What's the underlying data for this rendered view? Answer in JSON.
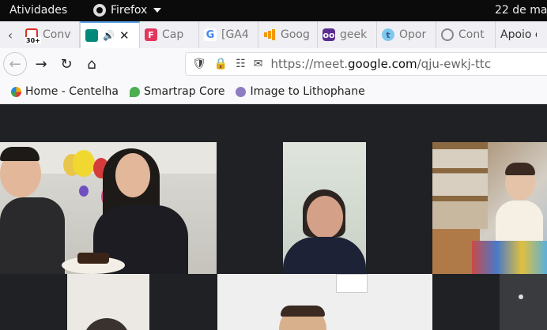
{
  "topbar": {
    "activities": "Atividades",
    "app_name": "Firefox",
    "clock": "22 de mar"
  },
  "tabs": [
    {
      "label": "Conv",
      "icon": "gmail-icon",
      "badge": "30+"
    },
    {
      "label": "",
      "icon": "meet-icon",
      "active": true,
      "audio": true
    },
    {
      "label": "Cap",
      "icon": "cap-icon"
    },
    {
      "label": "[GA4",
      "icon": "google-icon"
    },
    {
      "label": "Goog",
      "icon": "analytics-icon"
    },
    {
      "label": "geek",
      "icon": "geek-icon"
    },
    {
      "label": "Opor",
      "icon": "t-icon"
    },
    {
      "label": "Cont",
      "icon": "globe-icon"
    },
    {
      "label": "Apoio e"
    }
  ],
  "navbar": {
    "url_prefix": "https://meet.",
    "url_domain": "google.com",
    "url_path": "/qju-ewkj-ttc"
  },
  "bookmarks": [
    {
      "label": "Home - Centelha"
    },
    {
      "label": "Smartrap Core"
    },
    {
      "label": "Image to Lithophane"
    }
  ],
  "colors": {
    "meet_background": "#202124",
    "active_tab_accent": "#5aa0e6"
  }
}
